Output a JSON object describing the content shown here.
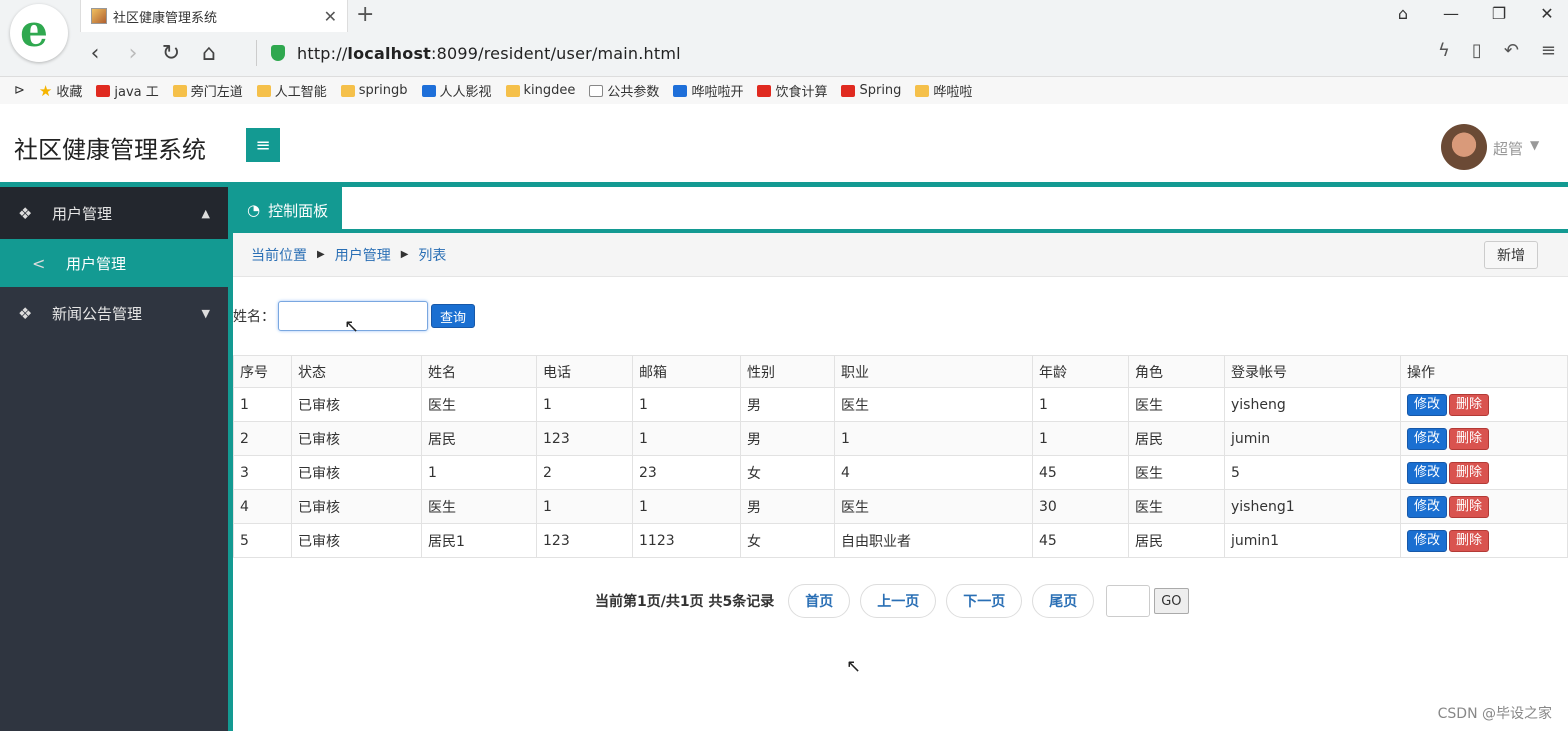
{
  "browser": {
    "tab_title": "社区健康管理系统",
    "tab_close": "✕",
    "new_tab": "+",
    "url_prefix": "http://",
    "url_host": "localhost",
    "url_rest": ":8099/resident/user/main.html",
    "bookmarks": [
      "收藏",
      "java 工",
      "旁门左道",
      "人工智能",
      "springb",
      "人人影视",
      "kingdee",
      "公共参数",
      "哗啦啦开",
      "饮食计算",
      "Spring",
      "哗啦啦"
    ]
  },
  "header": {
    "title": "社区健康管理系统",
    "user_name": "超管"
  },
  "sidebar": {
    "items": [
      {
        "label": "用户管理"
      },
      {
        "label": "用户管理"
      },
      {
        "label": "新闻公告管理"
      }
    ]
  },
  "tabs": {
    "dashboard": "控制面板"
  },
  "breadcrumb": [
    "当前位置",
    "用户管理",
    "列表"
  ],
  "toolbar": {
    "add_label": "新增"
  },
  "search": {
    "label": "姓名：",
    "value": "",
    "button": "查询"
  },
  "table": {
    "headers": [
      "序号",
      "状态",
      "姓名",
      "电话",
      "邮箱",
      "性别",
      "职业",
      "年龄",
      "角色",
      "登录帐号",
      "操作"
    ],
    "rows": [
      [
        "1",
        "已审核",
        "医生",
        "1",
        "1",
        "男",
        "医生",
        "1",
        "医生",
        "yisheng"
      ],
      [
        "2",
        "已审核",
        "居民",
        "123",
        "1",
        "男",
        "1",
        "1",
        "居民",
        "jumin"
      ],
      [
        "3",
        "已审核",
        "1",
        "2",
        "23",
        "女",
        "4",
        "45",
        "医生",
        "5"
      ],
      [
        "4",
        "已审核",
        "医生",
        "1",
        "1",
        "男",
        "医生",
        "30",
        "医生",
        "yisheng1"
      ],
      [
        "5",
        "已审核",
        "居民1",
        "123",
        "1123",
        "女",
        "自由职业者",
        "45",
        "居民",
        "jumin1"
      ]
    ],
    "edit_label": "修改",
    "delete_label": "删除"
  },
  "pager": {
    "info": "当前第1页/共1页  共5条记录",
    "first": "首页",
    "prev": "上一页",
    "next": "下一页",
    "last": "尾页",
    "go": "GO"
  },
  "watermark": "CSDN @毕设之家",
  "colors": {
    "accent": "#139a92",
    "sidebar": "#2f3540",
    "primary_btn": "#1a6fd1",
    "danger_btn": "#d9534f"
  }
}
